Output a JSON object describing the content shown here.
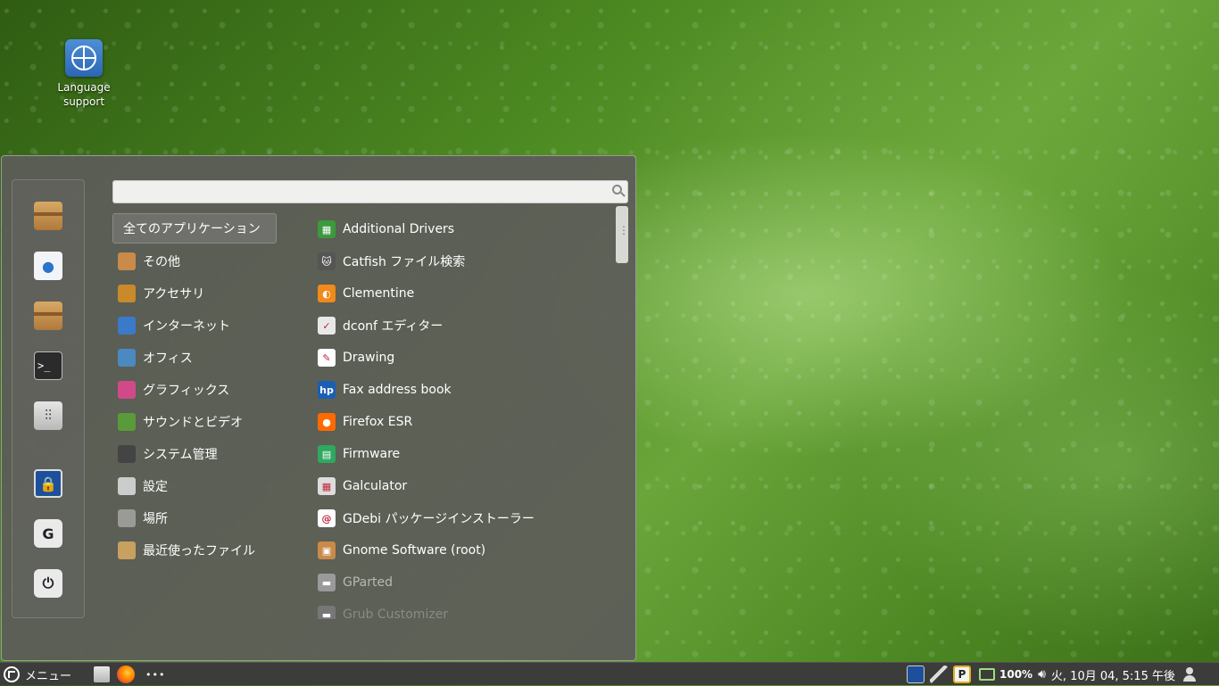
{
  "desktop": {
    "icons": [
      {
        "label_line1": "Language",
        "label_line2": "support"
      }
    ]
  },
  "menu": {
    "search": {
      "placeholder": ""
    },
    "categories": [
      {
        "label": "全てのアプリケーション",
        "icon": "all-apps-icon",
        "color": "#6f6f6b"
      },
      {
        "label": "その他",
        "icon": "other-icon",
        "color": "#c98a4a"
      },
      {
        "label": "アクセサリ",
        "icon": "accessories-icon",
        "color": "#c98a2a"
      },
      {
        "label": "インターネット",
        "icon": "internet-icon",
        "color": "#3a7ac8"
      },
      {
        "label": "オフィス",
        "icon": "office-icon",
        "color": "#4a8ac0"
      },
      {
        "label": "グラフィックス",
        "icon": "graphics-icon",
        "color": "#d04a8a"
      },
      {
        "label": "サウンドとビデオ",
        "icon": "sound-video-icon",
        "color": "#5a9a3a"
      },
      {
        "label": "システム管理",
        "icon": "system-admin-icon",
        "color": "#444444"
      },
      {
        "label": "設定",
        "icon": "settings-icon",
        "color": "#cccccc"
      },
      {
        "label": "場所",
        "icon": "places-icon",
        "color": "#9a9a96"
      },
      {
        "label": "最近使ったファイル",
        "icon": "recent-files-icon",
        "color": "#c8a060"
      }
    ],
    "apps": [
      {
        "label": "Additional Drivers",
        "icon": "chip-icon",
        "color": "#3c9a3c",
        "glyph": "▦"
      },
      {
        "label": "Catfish ファイル検索",
        "icon": "catfish-icon",
        "color": "#555555",
        "glyph": "🐱"
      },
      {
        "label": "Clementine",
        "icon": "clementine-icon",
        "color": "#f08a1a",
        "glyph": "◐"
      },
      {
        "label": "dconf エディター",
        "icon": "dconf-icon",
        "color": "#e8e8e8",
        "glyph": "✓"
      },
      {
        "label": "Drawing",
        "icon": "drawing-icon",
        "color": "#ffffff",
        "glyph": "✎"
      },
      {
        "label": "Fax address book",
        "icon": "hp-icon",
        "color": "#1a5fb4",
        "glyph": "hp"
      },
      {
        "label": "Firefox ESR",
        "icon": "firefox-icon",
        "color": "#ff6a00",
        "glyph": "●"
      },
      {
        "label": "Firmware",
        "icon": "firmware-icon",
        "color": "#2fa860",
        "glyph": "▤"
      },
      {
        "label": "Galculator",
        "icon": "calculator-icon",
        "color": "#dddddd",
        "glyph": "▦"
      },
      {
        "label": "GDebi パッケージインストーラー",
        "icon": "debian-icon",
        "color": "#ffffff",
        "glyph": "@"
      },
      {
        "label": "Gnome Software (root)",
        "icon": "software-icon",
        "color": "#c98a4a",
        "glyph": "▣"
      },
      {
        "label": "GParted",
        "icon": "gparted-icon",
        "color": "#9a9a9a",
        "glyph": "▬"
      },
      {
        "label": "Grub Customizer",
        "icon": "grub-icon",
        "color": "#777777",
        "glyph": "▬"
      }
    ]
  },
  "taskbar": {
    "menu_label": "メニュー",
    "more": "•••",
    "battery": "100%",
    "clock": "火, 10月 04,  5:15 午後"
  }
}
